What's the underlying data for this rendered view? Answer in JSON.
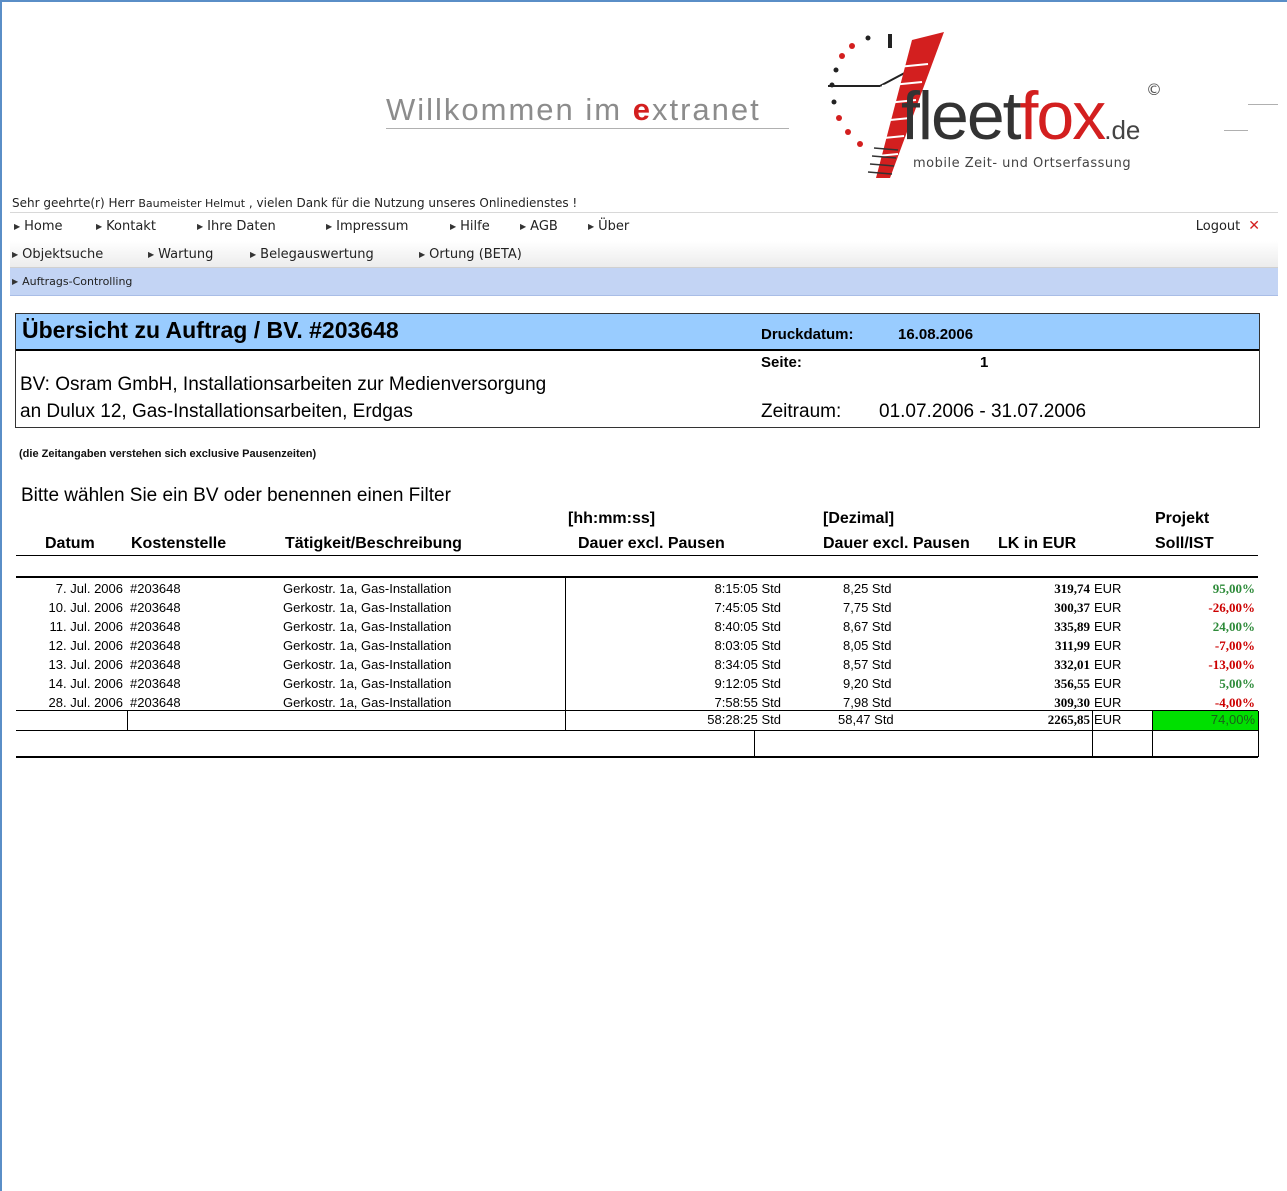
{
  "header": {
    "welcome_prefix": "Willkommen im ",
    "welcome_e": "e",
    "welcome_suffix": "xtranet",
    "brand_fleet": "fleet",
    "brand_fox": "fox",
    "brand_de": ".de",
    "brand_copy": "©",
    "slogan": "mobile Zeit- und Ortserfassung"
  },
  "greeting": {
    "prefix": "Sehr geehrte(r) Herr ",
    "user": "Baumeister Helmut",
    "suffix": " , vielen Dank für die Nutzung unseres Onlinedienstes !"
  },
  "nav_main": [
    {
      "label": "Home"
    },
    {
      "label": "Kontakt"
    },
    {
      "label": "Ihre Daten"
    },
    {
      "label": "Impressum"
    },
    {
      "label": "Hilfe"
    },
    {
      "label": "AGB"
    },
    {
      "label": "Über"
    }
  ],
  "logout": {
    "label": "Logout",
    "icon": "close-icon"
  },
  "nav_sub": [
    {
      "label": "Objektsuche"
    },
    {
      "label": "Wartung"
    },
    {
      "label": "Belegauswertung"
    },
    {
      "label": "Ortung (BETA)"
    }
  ],
  "nav_third": [
    {
      "label": "Auftrags-Controlling"
    }
  ],
  "report": {
    "title": "Übersicht zu Auftrag / BV. #203648",
    "druckdatum_label": "Druckdatum:",
    "druckdatum": "16.08.2006",
    "seite_label": "Seite:",
    "seite": "1",
    "bv_line1": "BV: Osram GmbH, Installationsarbeiten zur Medienversorgung",
    "bv_line2": "an Dulux 12, Gas-Installationsarbeiten, Erdgas",
    "zeitraum_label": "Zeitraum:",
    "zeitraum": "01.07.2006 - 31.07.2006"
  },
  "note": "(die Zeitangaben verstehen sich exclusive Pausenzeiten)",
  "filter_hint": "Bitte wählen Sie ein BV oder benennen einen Filter",
  "table": {
    "headers": {
      "datum": "Datum",
      "kostenstelle": "Kostenstelle",
      "taetigkeit": "Tätigkeit/Beschreibung",
      "hhmmss_top": "[hh:mm:ss]",
      "hhmmss": "Dauer excl. Pausen",
      "dezimal_top": "[Dezimal]",
      "dezimal": "Dauer excl. Pausen",
      "lk": "LK in EUR",
      "projekt_top": "Projekt",
      "projekt": "Soll/IST"
    },
    "rows": [
      {
        "datum": "7. Jul. 2006",
        "kst": "#203648",
        "desc": "Gerkostr. 1a, Gas-Installation",
        "dauer": "8:15:05 Std",
        "dezimal": "8,25 Std",
        "lk": "319,74",
        "cur": "EUR",
        "pct": "95,00%",
        "pct_color": "green"
      },
      {
        "datum": "10. Jul. 2006",
        "kst": "#203648",
        "desc": "Gerkostr. 1a, Gas-Installation",
        "dauer": "7:45:05 Std",
        "dezimal": "7,75 Std",
        "lk": "300,37",
        "cur": "EUR",
        "pct": "-26,00%",
        "pct_color": "red"
      },
      {
        "datum": "11. Jul. 2006",
        "kst": "#203648",
        "desc": "Gerkostr. 1a, Gas-Installation",
        "dauer": "8:40:05 Std",
        "dezimal": "8,67 Std",
        "lk": "335,89",
        "cur": "EUR",
        "pct": "24,00%",
        "pct_color": "green"
      },
      {
        "datum": "12. Jul. 2006",
        "kst": "#203648",
        "desc": "Gerkostr. 1a, Gas-Installation",
        "dauer": "8:03:05 Std",
        "dezimal": "8,05 Std",
        "lk": "311,99",
        "cur": "EUR",
        "pct": "-7,00%",
        "pct_color": "red"
      },
      {
        "datum": "13. Jul. 2006",
        "kst": "#203648",
        "desc": "Gerkostr. 1a, Gas-Installation",
        "dauer": "8:34:05 Std",
        "dezimal": "8,57 Std",
        "lk": "332,01",
        "cur": "EUR",
        "pct": "-13,00%",
        "pct_color": "red"
      },
      {
        "datum": "14. Jul. 2006",
        "kst": "#203648",
        "desc": "Gerkostr. 1a, Gas-Installation",
        "dauer": "9:12:05 Std",
        "dezimal": "9,20 Std",
        "lk": "356,55",
        "cur": "EUR",
        "pct": "5,00%",
        "pct_color": "green"
      },
      {
        "datum": "28. Jul. 2006",
        "kst": "#203648",
        "desc": "Gerkostr. 1a, Gas-Installation",
        "dauer": "7:58:55 Std",
        "dezimal": "7,98 Std",
        "lk": "309,30",
        "cur": "EUR",
        "pct": "-4,00%",
        "pct_color": "red"
      }
    ],
    "totals": {
      "dauer": "58:28:25 Std",
      "dezimal": "58,47 Std",
      "lk": "2265,85",
      "cur": "EUR",
      "pct": "74,00%"
    }
  },
  "colors": {
    "accent_red": "#d31f1f",
    "title_band": "#99ccff",
    "nav_highlight": "#c3d4f4",
    "positive": "#2e8b3a",
    "negative": "#cc0000",
    "total_pct_bg": "#00e000"
  }
}
